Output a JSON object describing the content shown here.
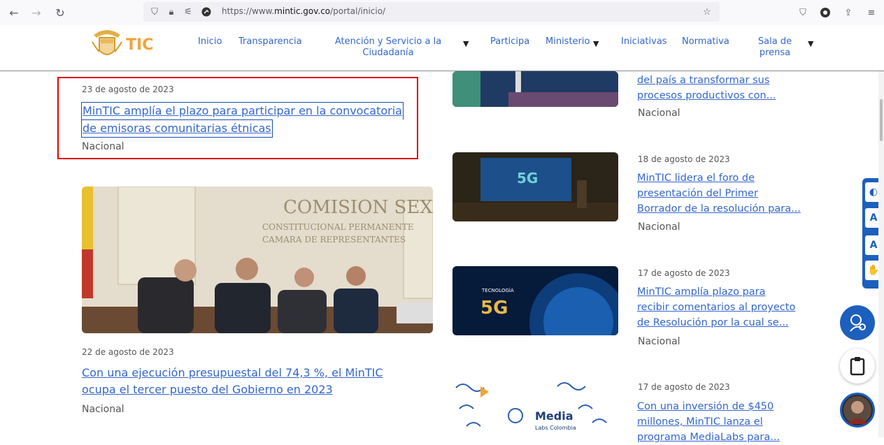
{
  "browser": {
    "url_prefix": "https://www.",
    "url_domain": "mintic.gov.co",
    "url_path": "/portal/inicio/"
  },
  "header": {
    "logo_text": "TIC",
    "nav": [
      "Inicio",
      "Transparencia",
      "Atención y Servicio a la Ciudadanía",
      "Participa",
      "Ministerio",
      "Iniciativas",
      "Normativa",
      "Sala de prensa"
    ]
  },
  "left_articles": [
    {
      "date": "23 de agosto de 2023",
      "title_line1": "MinTIC amplía el plazo para participar en la convocatoria",
      "title_line2": "de emisoras comunitarias étnicas",
      "category": "Nacional"
    },
    {
      "date": "22 de agosto de 2023",
      "title_line1": "Con una ejecución presupuestal del 74,3 %, el MinTIC",
      "title_line2": "ocupa el tercer puesto del Gobierno en 2023",
      "category": "Nacional",
      "image_text": {
        "line1": "COMISION SEXTA",
        "line2": "CONSTITUCIONAL PERMANENTE",
        "line3": "CAMARA DE REPRESENTANTES"
      }
    }
  ],
  "right_articles": [
    {
      "date": "",
      "title_lines": [
        "del país a transformar sus",
        "procesos productivos con..."
      ],
      "category": "Nacional"
    },
    {
      "date": "18 de agosto de 2023",
      "title_lines": [
        "MinTIC lidera el foro de",
        "presentación del Primer",
        "Borrador de la resolución para..."
      ],
      "category": "Nacional",
      "image_label": "5G"
    },
    {
      "date": "17 de agosto de 2023",
      "title_lines": [
        "MinTIC amplía plazo para",
        "recibir comentarios al proyecto",
        "de Resolución por la cual se..."
      ],
      "category": "Nacional",
      "image_label": "5G",
      "image_sublabel": "TECNOLOGÍA"
    },
    {
      "date": "17 de agosto de 2023",
      "title_lines": [
        "Con una inversión de $450",
        "millones, MinTIC lanza el",
        "programa MediaLabs para..."
      ],
      "category": "",
      "image_label": "Media",
      "image_sublabel": "Labs Colombia"
    }
  ],
  "a11y": [
    "contrast-icon",
    "increase-text-icon",
    "decrease-text-icon",
    "sign-language-icon"
  ],
  "colors": {
    "link": "#3366cc",
    "accent": "#f2a33a",
    "a11y_blue": "#1d5fbd",
    "highlight": "#e00000"
  }
}
